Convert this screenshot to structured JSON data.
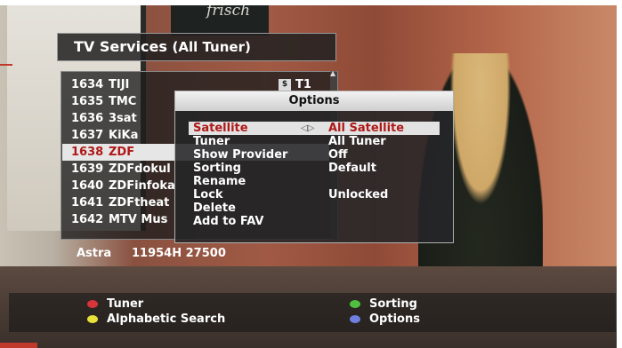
{
  "services_panel": {
    "title": "TV Services",
    "subtitle": "(All Tuner)",
    "channels": [
      {
        "number": "1634",
        "name": "TIJI",
        "flag": "$",
        "tuner": "T1"
      },
      {
        "number": "1635",
        "name": "TMC"
      },
      {
        "number": "1636",
        "name": "3sat"
      },
      {
        "number": "1637",
        "name": "KiKa"
      },
      {
        "number": "1638",
        "name": "ZDF",
        "selected": true
      },
      {
        "number": "1639",
        "name": "ZDFdokul"
      },
      {
        "number": "1640",
        "name": "ZDFinfoka"
      },
      {
        "number": "1641",
        "name": "ZDFtheat"
      },
      {
        "number": "1642",
        "name": "MTV Mus"
      }
    ],
    "satellite": "Astra",
    "transponder": "11954H 27500"
  },
  "options_dialog": {
    "title": "Options",
    "rows": [
      {
        "label": "Satellite",
        "value": "All Satellite",
        "arrows": "◁▷",
        "selected": true
      },
      {
        "label": "Tuner",
        "value": "All Tuner"
      },
      {
        "label": "Show Provider",
        "value": "Off"
      },
      {
        "label": "Sorting",
        "value": "Default"
      },
      {
        "label": "Rename",
        "value": ""
      },
      {
        "label": "Lock",
        "value": "Unlocked"
      },
      {
        "label": "Delete",
        "value": ""
      },
      {
        "label": "Add to FAV",
        "value": ""
      }
    ]
  },
  "color_keys": [
    {
      "color": "#d9343a",
      "label": "Tuner"
    },
    {
      "color": "#e8e13a",
      "label": "Alphabetic Search"
    },
    {
      "color": "#4fbf3f",
      "label": "Sorting"
    },
    {
      "color": "#6f7fe0",
      "label": "Options"
    }
  ],
  "background_board_text": "frisch"
}
